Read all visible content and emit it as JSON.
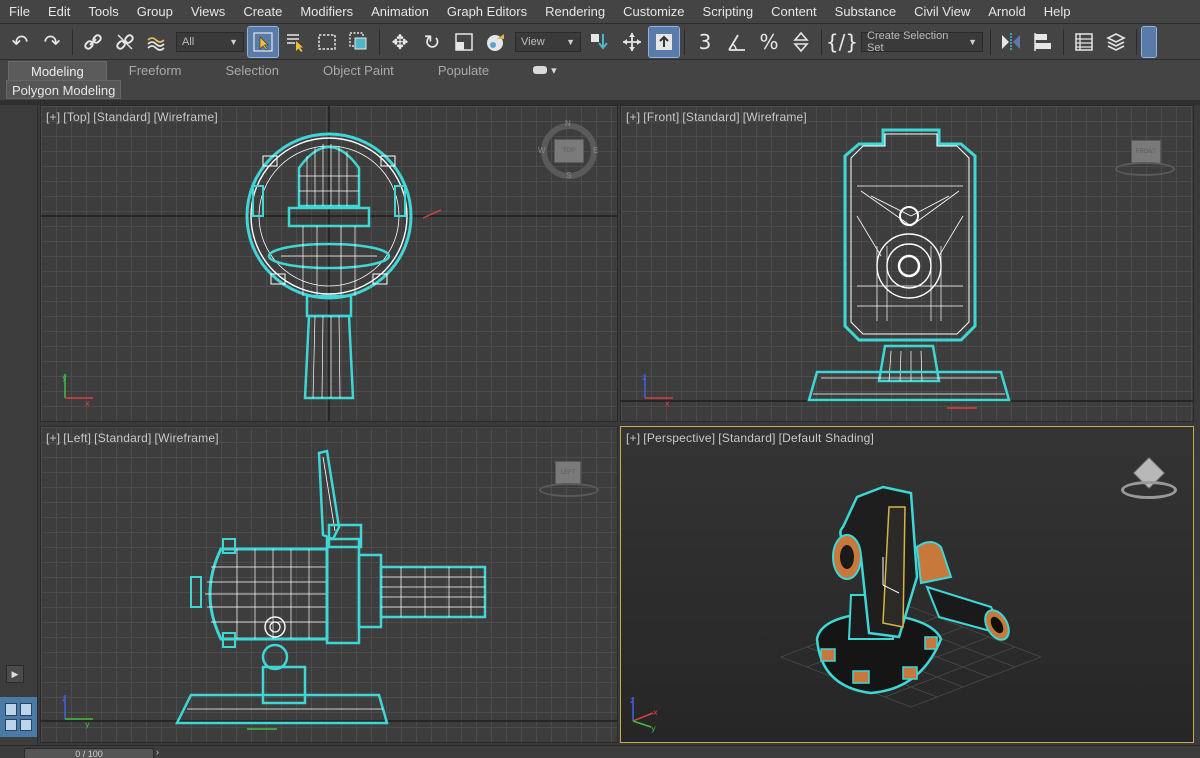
{
  "menu": {
    "items": [
      "File",
      "Edit",
      "Tools",
      "Group",
      "Views",
      "Create",
      "Modifiers",
      "Animation",
      "Graph Editors",
      "Rendering",
      "Customize",
      "Scripting",
      "Content",
      "Substance",
      "Civil View",
      "Arnold",
      "Help"
    ]
  },
  "toolbar": {
    "filter_dropdown": "All",
    "refcoord_dropdown": "View",
    "selection_set_dropdown": "Create Selection Set",
    "angle_snap_glyph": "3",
    "percent_snap_glyph": "%"
  },
  "ribbon": {
    "tabs": [
      "Modeling",
      "Freeform",
      "Selection",
      "Object Paint",
      "Populate"
    ],
    "active_tab": "Modeling",
    "sub_label": "Polygon Modeling"
  },
  "viewports": {
    "top": {
      "plus": "[+]",
      "view": "[Top]",
      "style": "[Standard]",
      "shading": "[Wireframe]"
    },
    "front": {
      "plus": "[+]",
      "view": "[Front]",
      "style": "[Standard]",
      "shading": "[Wireframe]"
    },
    "left": {
      "plus": "[+]",
      "view": "[Left]",
      "style": "[Standard]",
      "shading": "[Wireframe]"
    },
    "perspective": {
      "plus": "[+]",
      "view": "[Perspective]",
      "style": "[Standard]",
      "shading": "[Default Shading]"
    }
  },
  "viewcube": {
    "top_face": "TOP",
    "front_face": "FRONT",
    "left_face": "LEFT",
    "compass": {
      "n": "N",
      "s": "S",
      "e": "E",
      "w": "W"
    }
  },
  "axis": {
    "x": "x",
    "y": "y",
    "z": "z"
  },
  "timeline": {
    "frame": "0 / 100"
  },
  "colors": {
    "selection_outline": "#3fd6d6",
    "wire": "#ffffff",
    "axis_x": "#d84040",
    "axis_y": "#40c040",
    "axis_z": "#4060e0",
    "active_border": "#c9a94c",
    "accent_blue": "#5a7aa8",
    "orange": "#c8783a"
  },
  "icons": [
    "undo-icon",
    "redo-icon",
    "link-icon",
    "unlink-icon",
    "bind-spacewarp-icon",
    "select-object-icon",
    "select-by-name-icon",
    "rect-region-icon",
    "window-crossing-icon",
    "move-icon",
    "rotate-icon",
    "scale-icon",
    "placement-icon",
    "pivot-icon",
    "select-manipulate-icon",
    "keyboard-shortcut-icon",
    "snap-icon",
    "angle-snap-icon",
    "percent-snap-icon",
    "spinner-snap-icon",
    "named-sets-icon",
    "mirror-icon",
    "align-icon",
    "scene-explorer-icon",
    "layer-explorer-icon"
  ]
}
